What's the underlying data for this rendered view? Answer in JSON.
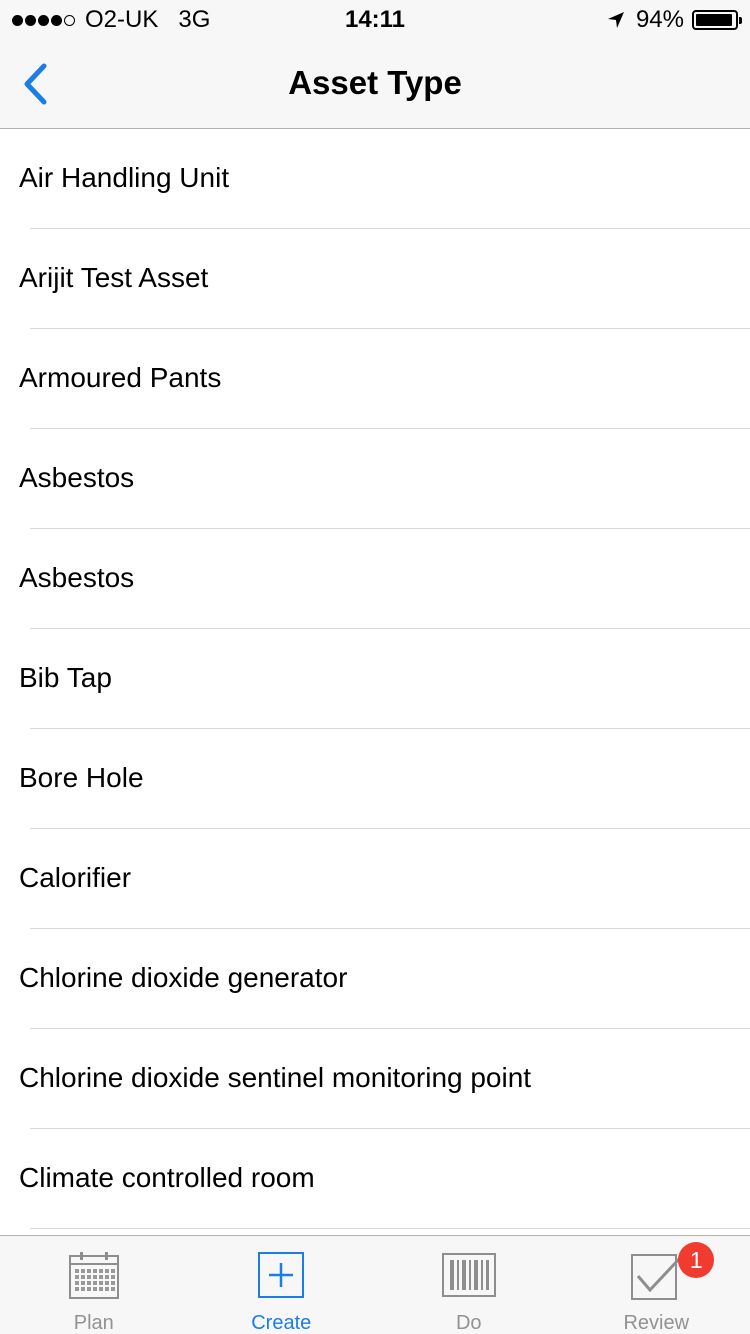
{
  "status_bar": {
    "carrier": "O2-UK",
    "network": "3G",
    "time": "14:11",
    "battery_percent": "94%",
    "battery_level": 0.94,
    "signal_bars_filled": 4,
    "signal_bars_total": 5
  },
  "nav": {
    "title": "Asset Type",
    "back_icon": "chevron-left-icon",
    "accent_color": "#1a7ee6"
  },
  "asset_types": [
    {
      "label": "Air Handling Unit"
    },
    {
      "label": "Arijit Test Asset"
    },
    {
      "label": "Armoured Pants"
    },
    {
      "label": "Asbestos"
    },
    {
      "label": "Asbestos"
    },
    {
      "label": "Bib Tap"
    },
    {
      "label": "Bore Hole"
    },
    {
      "label": "Calorifier"
    },
    {
      "label": "Chlorine dioxide generator"
    },
    {
      "label": "Chlorine dioxide sentinel monitoring point"
    },
    {
      "label": "Climate controlled room"
    }
  ],
  "tab_bar": {
    "tabs": [
      {
        "label": "Plan",
        "icon": "calendar-icon",
        "active": false
      },
      {
        "label": "Create",
        "icon": "plus-square-icon",
        "active": true
      },
      {
        "label": "Do",
        "icon": "barcode-icon",
        "active": false
      },
      {
        "label": "Review",
        "icon": "checkbox-icon",
        "active": false,
        "badge": "1"
      }
    ],
    "badge_color": "#f23b2f"
  }
}
